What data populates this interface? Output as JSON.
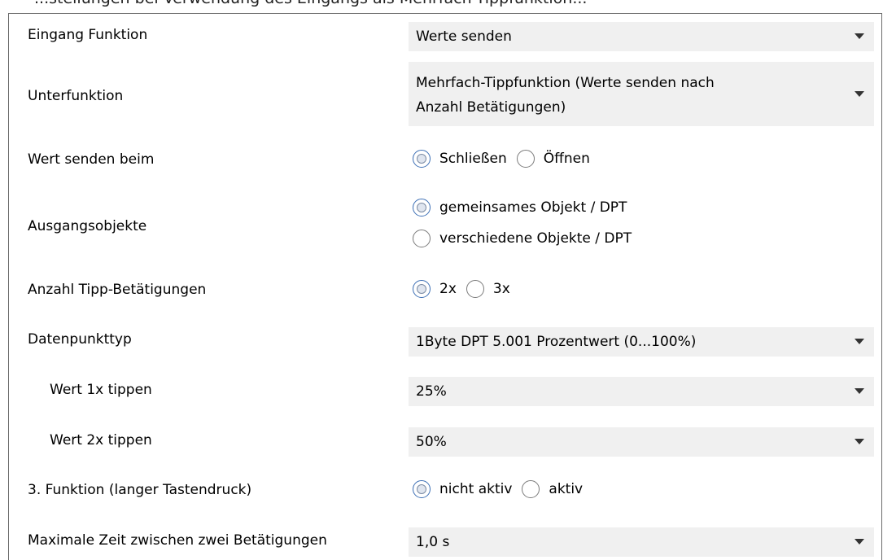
{
  "caption": "...stellungen bei Verwendung des Eingangs als Mehrfach-Tippfunktion...",
  "rows": {
    "eingang_funktion": {
      "label": "Eingang Funktion",
      "value": "Werte senden"
    },
    "unterfunktion": {
      "label": "Unterfunktion",
      "value_line1": "Mehrfach-Tippfunktion (Werte senden nach",
      "value_line2": "Anzahl Betätigungen)"
    },
    "wert_senden_beim": {
      "label": "Wert senden beim",
      "options": [
        "Schließen",
        "Öffnen"
      ],
      "selected": "Schließen"
    },
    "ausgangsobjekte": {
      "label": "Ausgangsobjekte",
      "options": [
        "gemeinsames Objekt / DPT",
        "verschiedene Objekte / DPT"
      ],
      "selected": "gemeinsames Objekt / DPT"
    },
    "anzahl_tipp": {
      "label": "Anzahl Tipp-Betätigungen",
      "options": [
        "2x",
        "3x"
      ],
      "selected": "2x"
    },
    "datenpunkttyp": {
      "label": "Datenpunkttyp",
      "value": "1Byte DPT 5.001 Prozentwert (0...100%)"
    },
    "wert_1x": {
      "label": "Wert 1x tippen",
      "value": "25%"
    },
    "wert_2x": {
      "label": "Wert 2x tippen",
      "value": "50%"
    },
    "funktion3": {
      "label": "3. Funktion (langer Tastendruck)",
      "options": [
        "nicht aktiv",
        "aktiv"
      ],
      "selected": "nicht aktiv"
    },
    "max_zeit": {
      "label": "Maximale Zeit zwischen zwei Betätigungen",
      "value": "1,0 s"
    }
  },
  "colors": {
    "dropdown_bg": "#f0f0f0",
    "border": "#6b6b6b",
    "radio_selected": "#3c6fb5"
  },
  "icons": {
    "dropdown_arrow": "chevron-down-icon",
    "radio": "radio-button"
  }
}
